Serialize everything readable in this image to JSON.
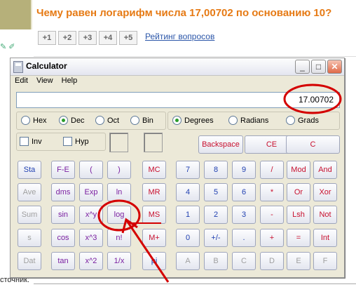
{
  "page": {
    "question": "Чему равен логарифм числа 17,00702 по основанию 10?",
    "votes": [
      "+1",
      "+2",
      "+3",
      "+4",
      "+5"
    ],
    "rating_link": "Рейтинг вопросов",
    "bottom_text": "сточник:"
  },
  "calc": {
    "title": "Calculator",
    "win_buttons": {
      "minimize": "_",
      "maximize": "□",
      "close": "✕"
    },
    "menu": [
      "Edit",
      "View",
      "Help"
    ],
    "display": "17.00702",
    "base": {
      "options": [
        "Hex",
        "Dec",
        "Oct",
        "Bin"
      ],
      "selected": "Dec"
    },
    "angle": {
      "options": [
        "Degrees",
        "Radians",
        "Grads"
      ],
      "selected": "Degrees"
    },
    "checks": [
      "Inv",
      "Hyp"
    ],
    "top_keys": [
      "Backspace",
      "CE",
      "C"
    ],
    "left_col": [
      "Sta",
      "Ave",
      "Sum",
      "s",
      "Dat"
    ],
    "func_rows": [
      [
        "F-E",
        "(",
        ")"
      ],
      [
        "dms",
        "Exp",
        "ln"
      ],
      [
        "sin",
        "x^y",
        "log"
      ],
      [
        "cos",
        "x^3",
        "n!"
      ],
      [
        "tan",
        "x^2",
        "1/x"
      ]
    ],
    "mem_col": [
      "MC",
      "MR",
      "MS",
      "M+",
      "pi"
    ],
    "num_rows": [
      [
        "7",
        "8",
        "9",
        "/",
        "Mod",
        "And"
      ],
      [
        "4",
        "5",
        "6",
        "*",
        "Or",
        "Xor"
      ],
      [
        "1",
        "2",
        "3",
        "-",
        "Lsh",
        "Not"
      ],
      [
        "0",
        "+/-",
        ".",
        "+",
        "=",
        "Int"
      ],
      [
        "A",
        "B",
        "C",
        "D",
        "E",
        "F"
      ]
    ],
    "colors": {
      "blue_key": "#1f3fb0",
      "red_key": "#c8102e",
      "purple_key": "#7a1fa0",
      "annotation": "#d40000"
    }
  }
}
